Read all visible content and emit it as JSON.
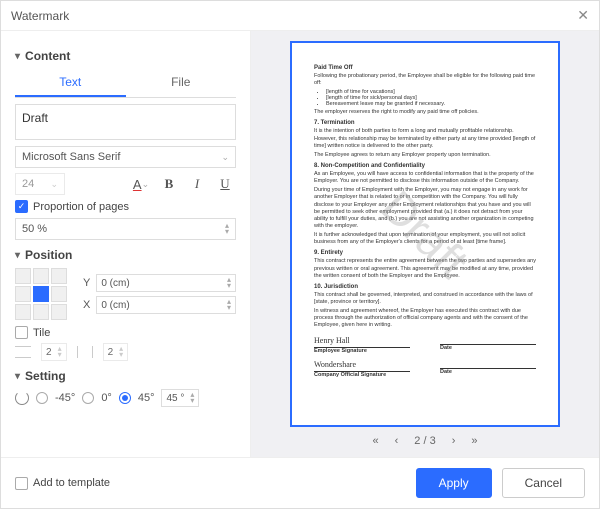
{
  "dialog": {
    "title": "Watermark"
  },
  "sections": {
    "content": "Content",
    "position": "Position",
    "setting": "Setting"
  },
  "tabs": {
    "text": "Text",
    "file": "File"
  },
  "content": {
    "text_value": "Draft",
    "font": "Microsoft Sans Serif",
    "size": "24",
    "proportion_label": "Proportion of pages",
    "proportion_value": "50 %"
  },
  "position": {
    "y_label": "Y",
    "y_value": "0 (cm)",
    "x_label": "X",
    "x_value": "0 (cm)",
    "tile_label": "Tile",
    "tile_v": "2",
    "tile_h": "2"
  },
  "setting": {
    "neg45": "-45°",
    "zero": "0°",
    "pos45": "45°",
    "custom": "45 °"
  },
  "preview_ui": {
    "watermark_text": "Draft",
    "pto_h": "Paid Time Off",
    "pto_p": "Following the probationary period, the Employee shall be eligible for the following paid time off:",
    "li1": "[length of time for vacations]",
    "li2": "[length of time for sick/personal days]",
    "li3": "Bereavement leave may be granted if necessary.",
    "pto_p2": "The employer reserves the right to modify any paid time off policies.",
    "term_h": "7.   Termination",
    "term_p1": "It is the intention of both parties to form a long and mutually profitable relationship. However, this relationship may be terminated by either party at any time provided [length of time] written notice is delivered to the other party.",
    "term_p2": "The Employee agrees to return any Employer property upon termination.",
    "nc_h": "8.   Non-Competition and Confidentiality",
    "nc_p1": "As an Employee, you will have access to confidential information that is the property of the Employer. You are not permitted to disclose this information outside of the Company.",
    "nc_p2": "During your time of Employment with the Employer, you may not engage in any work for another Employer that is related to or in competition with the Company. You will fully disclose to your Employer any other Employment relationships that you have and you will be permitted to seek other employment provided that (a.) it does not detract from your ability to fulfill your duties, and (b.) you are not assisting another organization in competing with the employer.",
    "nc_p3": "It is further acknowledged that upon termination of your employment, you will not solicit business from any of the Employer's clients for a period of at least [time frame].",
    "ent_h": "9.   Entirety",
    "ent_p": "This contract represents the entire agreement between the two parties and supersedes any previous written or oral agreement. This agreement may be modified at any time, provided the written consent of both the Employer and the Employee.",
    "jur_h": "10. Jurisdiction",
    "jur_p1": "This contract shall be governed, interpreted, and construed in accordance with the laws of [state, province or territory].",
    "jur_p2": "In witness and agreement whereof, the Employer has executed this contract with due process through the authorization of official company agents and with the consent of the Employee, given here in writing.",
    "sig1_name": "Henry Hall",
    "sig1_lbl": "Employee Signature",
    "date_lbl": "Date",
    "sig2_name": "Wondershare",
    "sig2_lbl": "Company Official Signature"
  },
  "nav": {
    "page": "2 / 3"
  },
  "footer": {
    "add_tpl": "Add to template",
    "apply": "Apply",
    "cancel": "Cancel"
  }
}
